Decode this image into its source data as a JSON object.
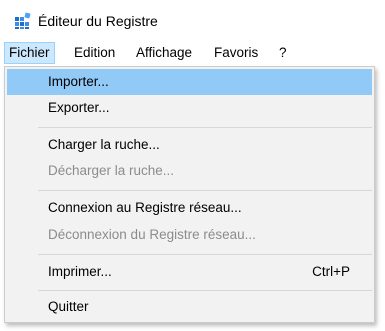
{
  "window": {
    "title": "Éditeur du Registre",
    "icon": "registry-editor-icon"
  },
  "menu_bar": {
    "items": [
      {
        "label": "Fichier",
        "active": true
      },
      {
        "label": "Edition",
        "active": false
      },
      {
        "label": "Affichage",
        "active": false
      },
      {
        "label": "Favoris",
        "active": false
      },
      {
        "label": "?",
        "active": false
      }
    ]
  },
  "file_menu": {
    "items": [
      {
        "label": "Importer...",
        "enabled": true,
        "highlighted": true
      },
      {
        "label": "Exporter...",
        "enabled": true
      },
      {
        "label": "Charger la ruche...",
        "enabled": true
      },
      {
        "label": "Décharger la ruche...",
        "enabled": false
      },
      {
        "label": "Connexion au Registre réseau...",
        "enabled": true
      },
      {
        "label": "Déconnexion du Registre réseau...",
        "enabled": false
      },
      {
        "label": "Imprimer...",
        "enabled": true,
        "shortcut": "Ctrl+P"
      },
      {
        "label": "Quitter",
        "enabled": true
      }
    ]
  },
  "colors": {
    "highlight": "#91c9f7",
    "active_menu_bg": "#cce8ff",
    "menu_bg": "#f2f2f2",
    "disabled_text": "#8c8c8c"
  }
}
